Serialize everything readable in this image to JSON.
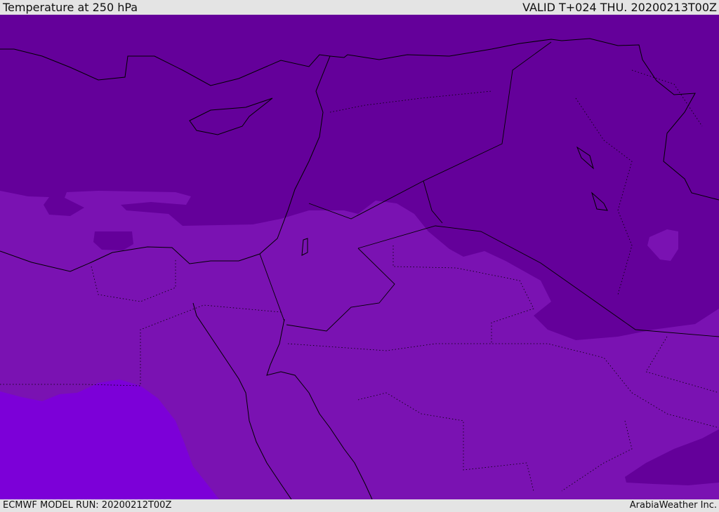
{
  "header": {
    "title": "Temperature at 250 hPa",
    "valid": "VALID T+024 THU. 20200213T00Z"
  },
  "footer": {
    "model_run": "ECMWF MODEL RUN: 20200212T00Z",
    "credit": "ArabiaWeather Inc."
  },
  "colors": {
    "cold_dark": "#64009a",
    "mid": "#7a12b2",
    "warm_bright": "#7c00d8",
    "coast": "#000000",
    "background": "#e4e4e4"
  }
}
